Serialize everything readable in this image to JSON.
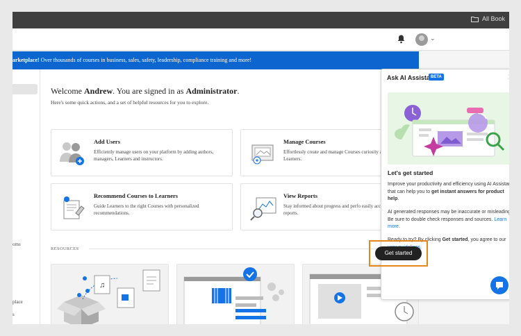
{
  "topbar": {
    "books_label": "All Book"
  },
  "banner": {
    "bold": "arketplace!",
    "text": " Over thousands of courses in business, sales, safety, leadership, compliance training and more!"
  },
  "leftnav": {
    "items": [
      "oms",
      "place",
      "s"
    ]
  },
  "welcome": {
    "prefix": "Welcome ",
    "name": "Andrew",
    "middle": ". You are signed in as ",
    "role": "Administrator",
    "suffix": ".",
    "subtext": "Here's some quick actions, and a set of helpful resources for you to explore."
  },
  "cards": [
    {
      "title": "Add Users",
      "desc": "Efficiently manage users on your platform by adding authors, managers, Learners and instructors."
    },
    {
      "title": "Manage Courses",
      "desc": "Effortlessly create and manage Courses curiosity and captivate Learners."
    },
    {
      "title": "Recommend Courses to Learners",
      "desc": "Guide Learners to the right Courses with personalized recommendations."
    },
    {
      "title": "View Reports",
      "desc": "Stay informed about progress and perfo easily accessible reports."
    }
  ],
  "resources": {
    "label": "RESOURCES"
  },
  "ai_panel": {
    "title": "Ask AI Assistant",
    "badge": "BETA",
    "close": "✕",
    "heading": "Let's get started",
    "p1_a": "Improve your productivity and efficiency using AI Assistant that can help you to ",
    "p1_b": "get instant answers for product help",
    "p1_c": ".",
    "p2_a": "AI generated responses may be inaccurate or misleading. Be sure to double check responses and sources. ",
    "p2_link": "Learn more",
    "p2_c": ".",
    "p3_a": "Ready to try? By clicking ",
    "p3_b": "Get started",
    "p3_c": ", you agree to our ",
    "p3_link": "user guidelines",
    "p3_d": ".",
    "button": "Get started"
  },
  "colors": {
    "accent": "#1473e6",
    "banner": "#0d66d0",
    "highlight": "#e68619"
  },
  "icons": [
    "bell-icon",
    "avatar",
    "folder-icon",
    "close-icon",
    "chat-icon"
  ]
}
